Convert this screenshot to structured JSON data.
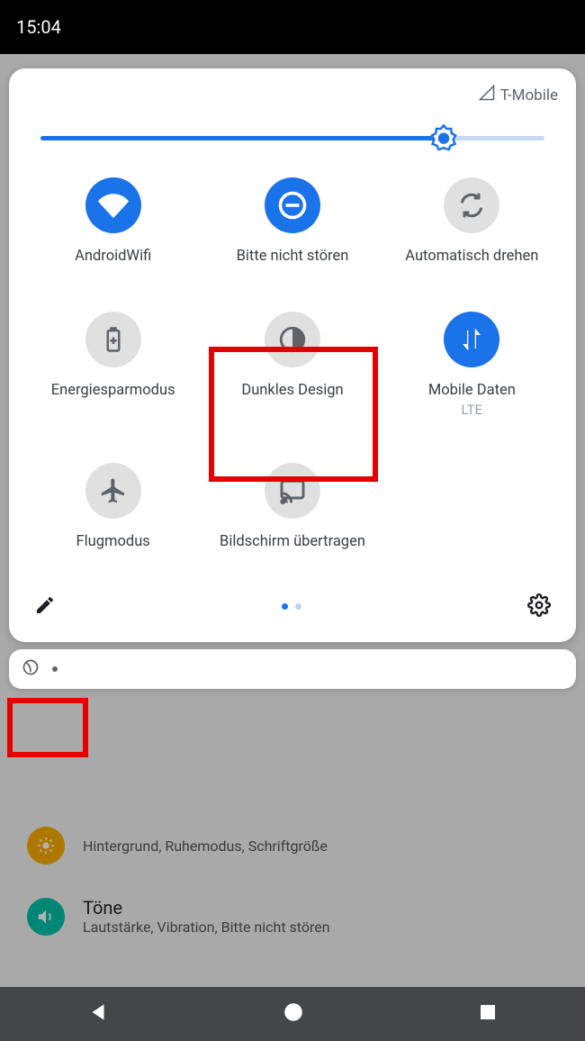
{
  "status": {
    "time": "15:04"
  },
  "header": {
    "carrier": "T-Mobile"
  },
  "brightness": {
    "percent": 80
  },
  "tiles": [
    {
      "label": "AndroidWifi",
      "sub": "",
      "on": true,
      "icon": "wifi"
    },
    {
      "label": "Bitte nicht stören",
      "sub": "",
      "on": true,
      "icon": "dnd"
    },
    {
      "label": "Automatisch drehen",
      "sub": "",
      "on": false,
      "icon": "rotate"
    },
    {
      "label": "Energiesparmodus",
      "sub": "",
      "on": false,
      "icon": "battery"
    },
    {
      "label": "Dunkles Design",
      "sub": "",
      "on": false,
      "icon": "darkmode"
    },
    {
      "label": "Mobile Daten",
      "sub": "LTE",
      "on": true,
      "icon": "mobiledata"
    },
    {
      "label": "Flugmodus",
      "sub": "",
      "on": false,
      "icon": "airplane"
    },
    {
      "label": "Bildschirm übertragen",
      "sub": "",
      "on": false,
      "icon": "cast"
    }
  ],
  "pager": {
    "active": 0,
    "count": 2
  },
  "background": {
    "rows": [
      {
        "title": "",
        "subtitle": "Hintergrund, Ruhemodus, Schriftgröße",
        "color": "#f9ab00",
        "icon": "display"
      },
      {
        "title": "Töne",
        "subtitle": "Lautstärke, Vibration, Bitte nicht stören",
        "color": "#00bfa5",
        "icon": "sound"
      }
    ]
  },
  "colors": {
    "accent": "#1a73e8",
    "inactive": "#9aa0a6"
  }
}
